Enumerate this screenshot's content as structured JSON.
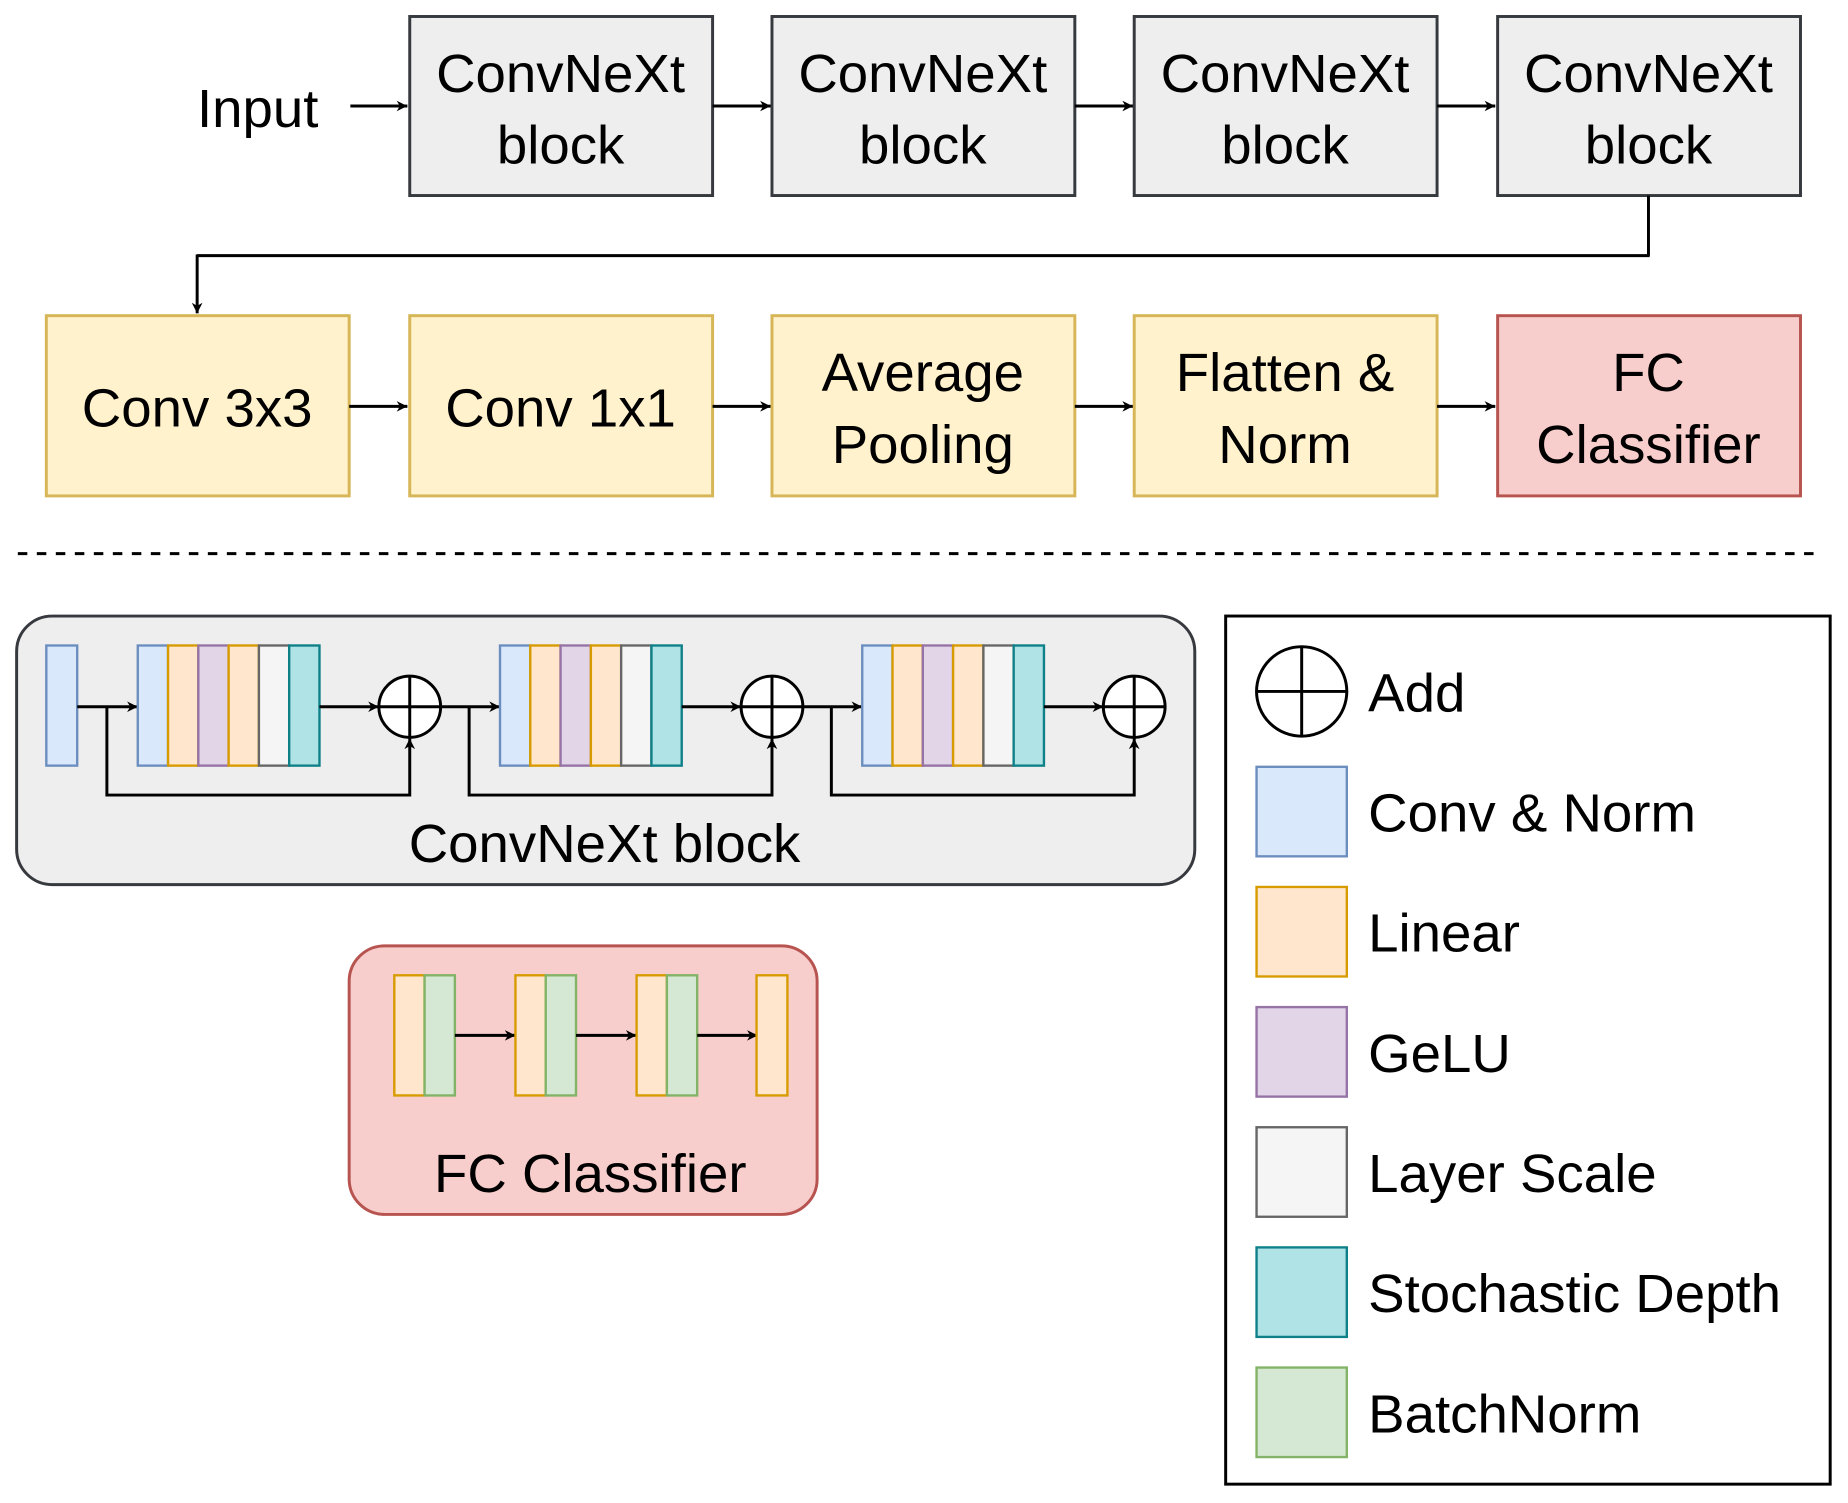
{
  "colors": {
    "convnext_fill": "#eeeeee",
    "convnext_stroke": "#36393d",
    "yellow_fill": "#fff2cc",
    "yellow_stroke": "#d6b656",
    "red_fill": "#f8cecc",
    "red_stroke": "#b85450",
    "conv_norm": [
      "#dae8fc",
      "#6c8ebf"
    ],
    "linear": [
      "#ffe6cc",
      "#d79b00"
    ],
    "gelu": [
      "#e1d5e7",
      "#9673a6"
    ],
    "layer_scale": [
      "#f5f5f5",
      "#666666"
    ],
    "stochastic_depth": [
      "#b0e3e6",
      "#0e8088"
    ],
    "batchnorm": [
      "#d5e8d4",
      "#82b366"
    ]
  },
  "top_row": {
    "input_label": "Input",
    "blocks": [
      {
        "line1": "ConvNeXt",
        "line2": "block"
      },
      {
        "line1": "ConvNeXt",
        "line2": "block"
      },
      {
        "line1": "ConvNeXt",
        "line2": "block"
      },
      {
        "line1": "ConvNeXt",
        "line2": "block"
      }
    ]
  },
  "second_row": [
    {
      "line1": "Conv 3x3",
      "line2": ""
    },
    {
      "line1": "Conv 1x1",
      "line2": ""
    },
    {
      "line1": "Average",
      "line2": "Pooling"
    },
    {
      "line1": "Flatten &",
      "line2": "Norm"
    },
    {
      "line1": "FC",
      "line2": "Classifier"
    }
  ],
  "convnext_detail": {
    "label": "ConvNeXt block"
  },
  "fc_detail": {
    "label": "FC Classifier"
  },
  "legend": [
    {
      "label": "Add",
      "icon": "add-circle-icon"
    },
    {
      "label": "Conv & Norm",
      "key": "conv_norm"
    },
    {
      "label": "Linear",
      "key": "linear"
    },
    {
      "label": "GeLU",
      "key": "gelu"
    },
    {
      "label": "Layer Scale",
      "key": "layer_scale"
    },
    {
      "label": "Stochastic Depth",
      "key": "stochastic_depth"
    },
    {
      "label": "BatchNorm",
      "key": "batchnorm"
    }
  ]
}
